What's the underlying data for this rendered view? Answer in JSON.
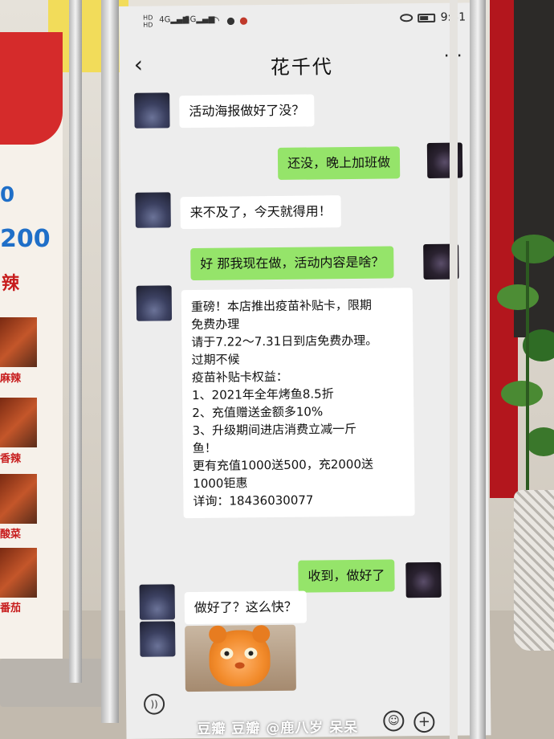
{
  "status_bar": {
    "network_tags": [
      "HD",
      "HD",
      "4G",
      "5G"
    ],
    "time": "9:31"
  },
  "chat": {
    "title": "花千代",
    "back_icon": "chevron-left-icon",
    "more_icon": "more-dots-icon"
  },
  "messages": [
    {
      "from": "them",
      "text": "活动海报做好了没？"
    },
    {
      "from": "me",
      "text": "还没，晚上加班做"
    },
    {
      "from": "them",
      "text": "来不及了，今天就得用！"
    },
    {
      "from": "me",
      "text": "好 那我现在做，活动内容是啥？"
    },
    {
      "from": "them",
      "lines": [
        "重磅！本店推出疫苗补贴卡，限期",
        "免费办理",
        "请于7.22～7.31日到店免费办理。",
        "过期不候",
        "疫苗补贴卡权益：",
        "1、2021年全年烤鱼8.5折",
        "2、充值赠送金额多10%",
        "3、升级期间进店消费立减一斤",
        "鱼！",
        "更有充值1000送500，充2000送",
        "1000钜惠",
        "详询：18436030077"
      ]
    },
    {
      "from": "me",
      "text": "收到，做好了"
    },
    {
      "from": "them",
      "text": "做好了？这么快？"
    },
    {
      "from": "them",
      "sticker": "orange-cat-sticker"
    }
  ],
  "bottom_bar": {
    "voice_icon": "voice-icon",
    "emoji_icon": "emoji-icon",
    "plus_icon": "plus-icon",
    "watermark": "豆瓣 豆瓣 @鹿八岁 呆呆"
  },
  "left_poster": {
    "numbers": [
      "0",
      "200"
    ],
    "labels": [
      "辣",
      "麻辣",
      "香辣",
      "酸菜",
      "番茄"
    ]
  }
}
